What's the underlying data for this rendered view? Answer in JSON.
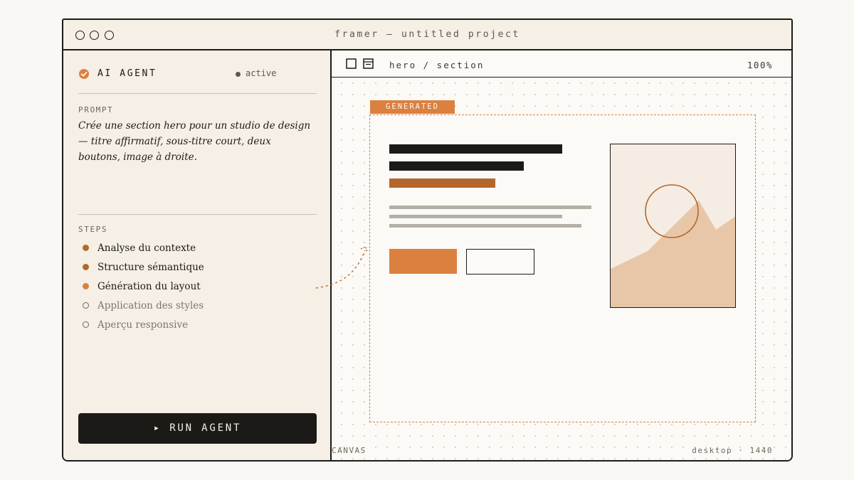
{
  "window": {
    "title": "framer — untitled project"
  },
  "sidebar": {
    "agent_title": "AI AGENT",
    "status": "active",
    "prompt_label": "PROMPT",
    "prompt_text": "Crée une section hero pour un studio de design — titre affirmatif, sous-titre court, deux boutons, image à droite.",
    "steps_label": "STEPS",
    "steps": [
      {
        "label": "Analyse du contexte",
        "state": "done"
      },
      {
        "label": "Structure sémantique",
        "state": "done"
      },
      {
        "label": "Génération du layout",
        "state": "current"
      },
      {
        "label": "Application des styles",
        "state": "pending"
      },
      {
        "label": "Aperçu responsive",
        "state": "pending"
      }
    ],
    "run_button": "▸  RUN AGENT"
  },
  "canvas": {
    "breadcrumb": "hero / section",
    "zoom": "100%",
    "badge": "GENERATED",
    "footer_left": "CANVAS",
    "footer_right": "desktop · 1440"
  },
  "colors": {
    "accent": "#dc8040",
    "accent_dark": "#b4672a",
    "ink": "#1c1a17",
    "panel": "#f5efe6",
    "canvas": "#fbfaf7",
    "image_fill": "#e8c7a8"
  },
  "icons": {
    "agent": "check-circle-icon",
    "tools": [
      "frame-icon",
      "layout-icon"
    ],
    "run": "play-icon"
  }
}
